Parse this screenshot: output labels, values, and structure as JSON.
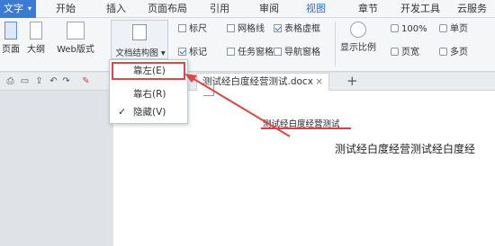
{
  "menubar": {
    "file_label": "文字",
    "tabs": [
      "开始",
      "插入",
      "页面布局",
      "引用",
      "审阅",
      "视图",
      "章节",
      "开发工具",
      "云服务"
    ],
    "active_tab": "视图"
  },
  "ribbon": {
    "view_buttons": [
      "页面",
      "大纲",
      "Web版式"
    ],
    "doc_structure_label": "文档结构图 ▾",
    "checkboxes": [
      {
        "label": "标尺",
        "checked": false
      },
      {
        "label": "网格线",
        "checked": false
      },
      {
        "label": "表格虚框",
        "checked": true
      },
      {
        "label": "标记",
        "checked": true
      },
      {
        "label": "任务窗格",
        "checked": false
      },
      {
        "label": "导航窗格",
        "checked": false
      }
    ],
    "zoom_label": "显示比例",
    "zoom_percent": "100%",
    "page_width": "页宽",
    "single_page": "单页",
    "multi_page": "多页"
  },
  "tabbar": {
    "doc_tab_label": "测试经白度经营测试.docx",
    "close": "×",
    "new_tab": "+"
  },
  "dropdown": {
    "items": [
      "靠左(E)",
      "靠右(R)",
      "隐藏(V)"
    ],
    "checked_index": 2
  },
  "document": {
    "heading": "测试经白度经营测试",
    "body": "测试经白度经营测试经白度经"
  },
  "colors": {
    "accent": "#3b7bd4",
    "annotation": "#e24545"
  }
}
